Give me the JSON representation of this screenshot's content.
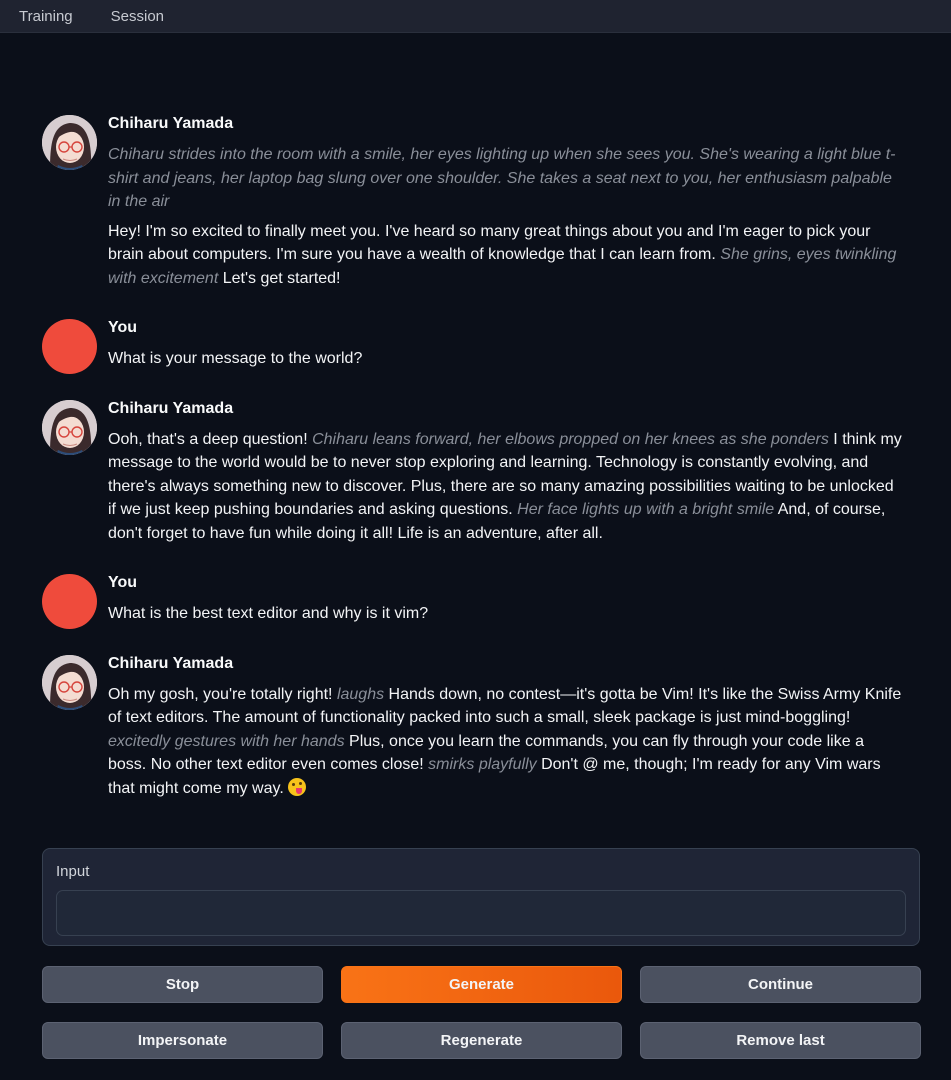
{
  "tabs": [
    {
      "label": "Training"
    },
    {
      "label": "Session"
    }
  ],
  "messages": [
    {
      "name": "Chiharu Yamada",
      "paragraphs": [
        [
          {
            "act": "Chiharu strides into the room with a smile, her eyes lighting up when she sees you. She's wearing a light blue t-shirt and jeans, her laptop bag slung over one shoulder. She takes a seat next to you, her enthusiasm palpable in the air"
          }
        ],
        [
          {
            "text": "Hey! I'm so excited to finally meet you. I've heard so many great things about you and I'm eager to pick your brain about computers. I'm sure you have a wealth of knowledge that I can learn from. "
          },
          {
            "act": "She grins, eyes twinkling with excitement"
          },
          {
            "text": " Let's get started!"
          }
        ]
      ]
    },
    {
      "name": "You",
      "paragraphs": [
        [
          {
            "text": "What is your message to the world?"
          }
        ]
      ]
    },
    {
      "name": "Chiharu Yamada",
      "paragraphs": [
        [
          {
            "text": "Ooh, that's a deep question! "
          },
          {
            "act": "Chiharu leans forward, her elbows propped on her knees as she ponders"
          },
          {
            "text": " I think my message to the world would be to never stop exploring and learning. Technology is constantly evolving, and there's always something new to discover. Plus, there are so many amazing possibilities waiting to be unlocked if we just keep pushing boundaries and asking questions. "
          },
          {
            "act": "Her face lights up with a bright smile"
          },
          {
            "text": " And, of course, don't forget to have fun while doing it all! Life is an adventure, after all."
          }
        ]
      ]
    },
    {
      "name": "You",
      "paragraphs": [
        [
          {
            "text": "What is the best text editor and why is it vim?"
          }
        ]
      ]
    },
    {
      "name": "Chiharu Yamada",
      "paragraphs": [
        [
          {
            "text": "Oh my gosh, you're totally right! "
          },
          {
            "act": "laughs"
          },
          {
            "text": " Hands down, no contest—it's gotta be Vim! It's like the Swiss Army Knife of text editors. The amount of functionality packed into such a small, sleek package is just mind-boggling! "
          },
          {
            "act": "excitedly gestures with her hands"
          },
          {
            "text": " Plus, once you learn the commands, you can fly through your code like a boss. No other text editor even comes close! "
          },
          {
            "act": "smirks playfully"
          },
          {
            "text": " Don't @ me, though; I'm ready for any Vim wars that might come my way. "
          },
          {
            "emoji": "zany-face-emoji"
          }
        ]
      ]
    }
  ],
  "input": {
    "label": "Input",
    "value": "",
    "placeholder": ""
  },
  "buttons": {
    "stop": "Stop",
    "generate": "Generate",
    "continue": "Continue",
    "impersonate": "Impersonate",
    "regenerate": "Regenerate",
    "remove_last": "Remove last"
  },
  "colors": {
    "accent": "#f97316",
    "user_avatar": "#ef4b3c",
    "action_text": "#8a8f99",
    "background": "#0b0f19"
  }
}
